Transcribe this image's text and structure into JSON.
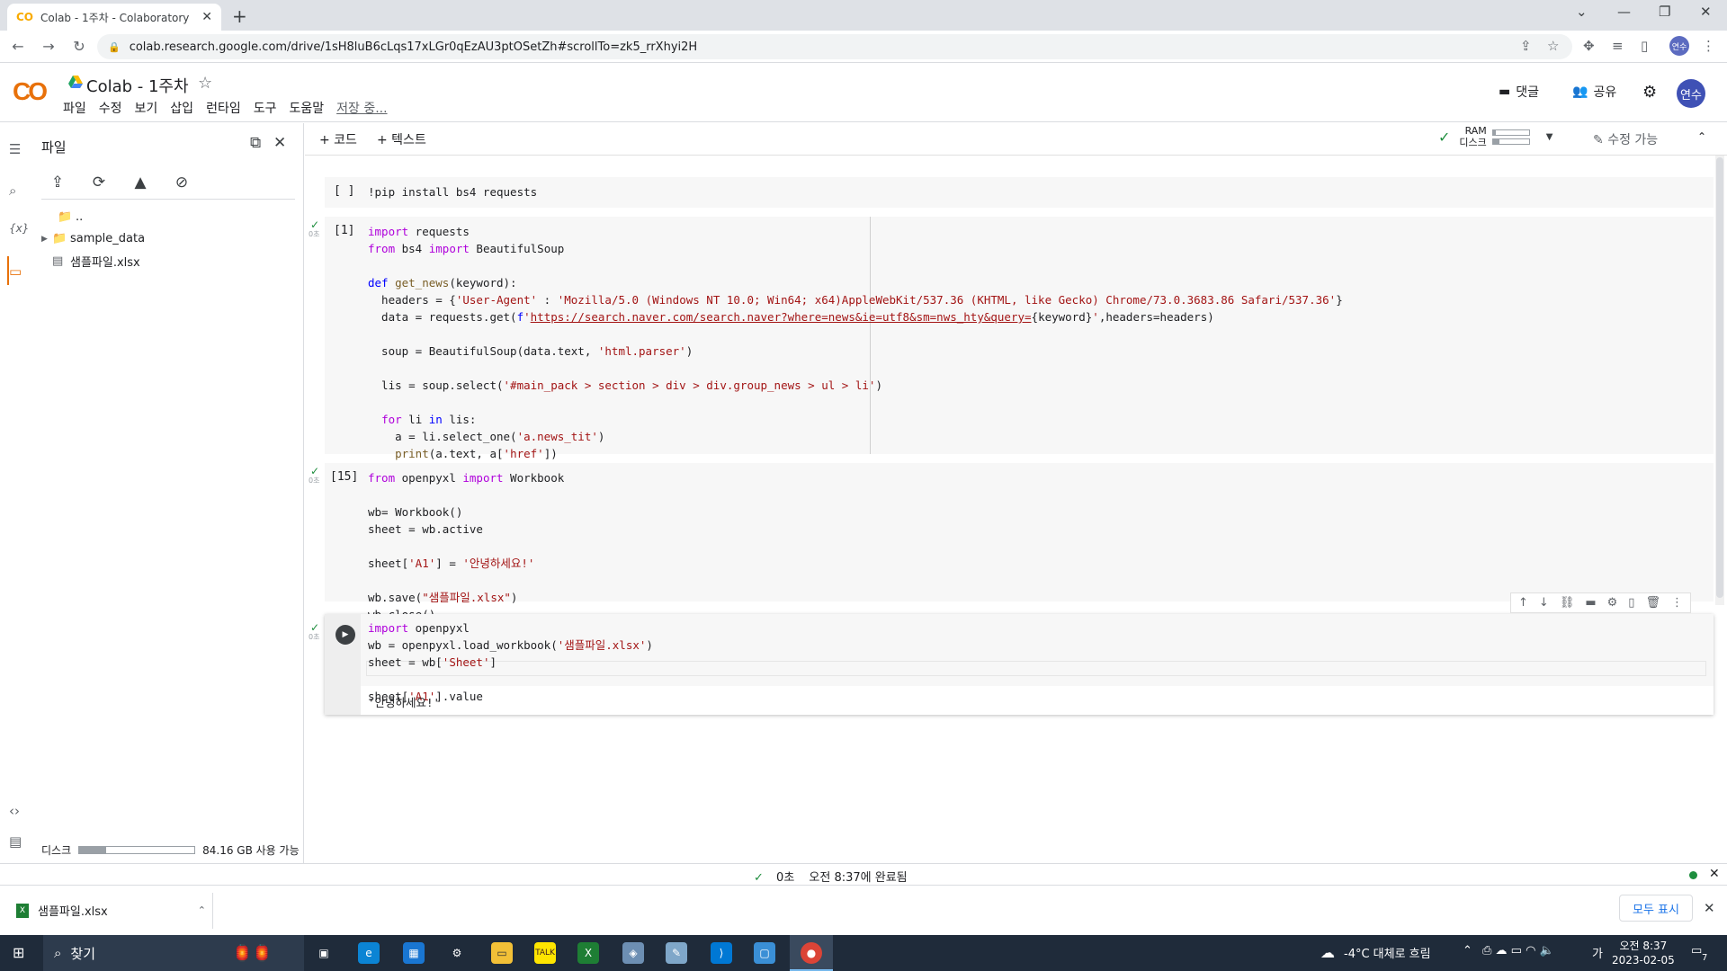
{
  "browser": {
    "tab_title": "Colab - 1주차 - Colaboratory",
    "favicon": "CO",
    "url": "colab.research.google.com/drive/1sH8luB6cLqs17xLGr0qEzAU3ptOSetZh#scrollTo=zk5_rrXhyi2H",
    "profile_initials": "연수"
  },
  "colab": {
    "logo": "CO",
    "notebook_title": "Colab - 1주차",
    "menu": [
      "파일",
      "수정",
      "보기",
      "삽입",
      "런타임",
      "도구",
      "도움말"
    ],
    "saving_label": "저장 중...",
    "comment_label": "댓글",
    "share_label": "공유",
    "avatar_initials": "연수"
  },
  "files_panel": {
    "title": "파일",
    "parent_dir": "..",
    "items": [
      {
        "name": "sample_data",
        "type": "folder"
      },
      {
        "name": "샘플파일.xlsx",
        "type": "file"
      }
    ],
    "disk_label": "디스크",
    "disk_free": "84.16 GB 사용 가능",
    "disk_used_fraction": 0.23
  },
  "notebook_toolbar": {
    "add_code": "+ 코드",
    "add_text": "+ 텍스트",
    "ram_label": "RAM",
    "disk_label": "디스크",
    "edit_label": "수정 가능"
  },
  "cells": {
    "c1": {
      "exec": "[ ]"
    },
    "c2": {
      "exec": "[1]",
      "time": "0초"
    },
    "c3": {
      "exec": "[15]",
      "time": "0초"
    },
    "c4": {
      "time": "0초",
      "output": "'안녕하세요!'"
    }
  },
  "statusbar": {
    "time": "0초",
    "message": "오전 8:37에 완료됨"
  },
  "downloads": {
    "file": "샘플파일.xlsx",
    "show_all": "모두 표시"
  },
  "taskbar": {
    "search": "찾기",
    "weather": "-4°C  대체로 흐림",
    "ime": "가",
    "time": "오전 8:37",
    "date": "2023-02-05",
    "notifications": "7"
  },
  "colors": {
    "accent_orange": "#f9ab00",
    "success_green": "#1e8e3e",
    "keyword": "#af00db",
    "string": "#a31515"
  }
}
